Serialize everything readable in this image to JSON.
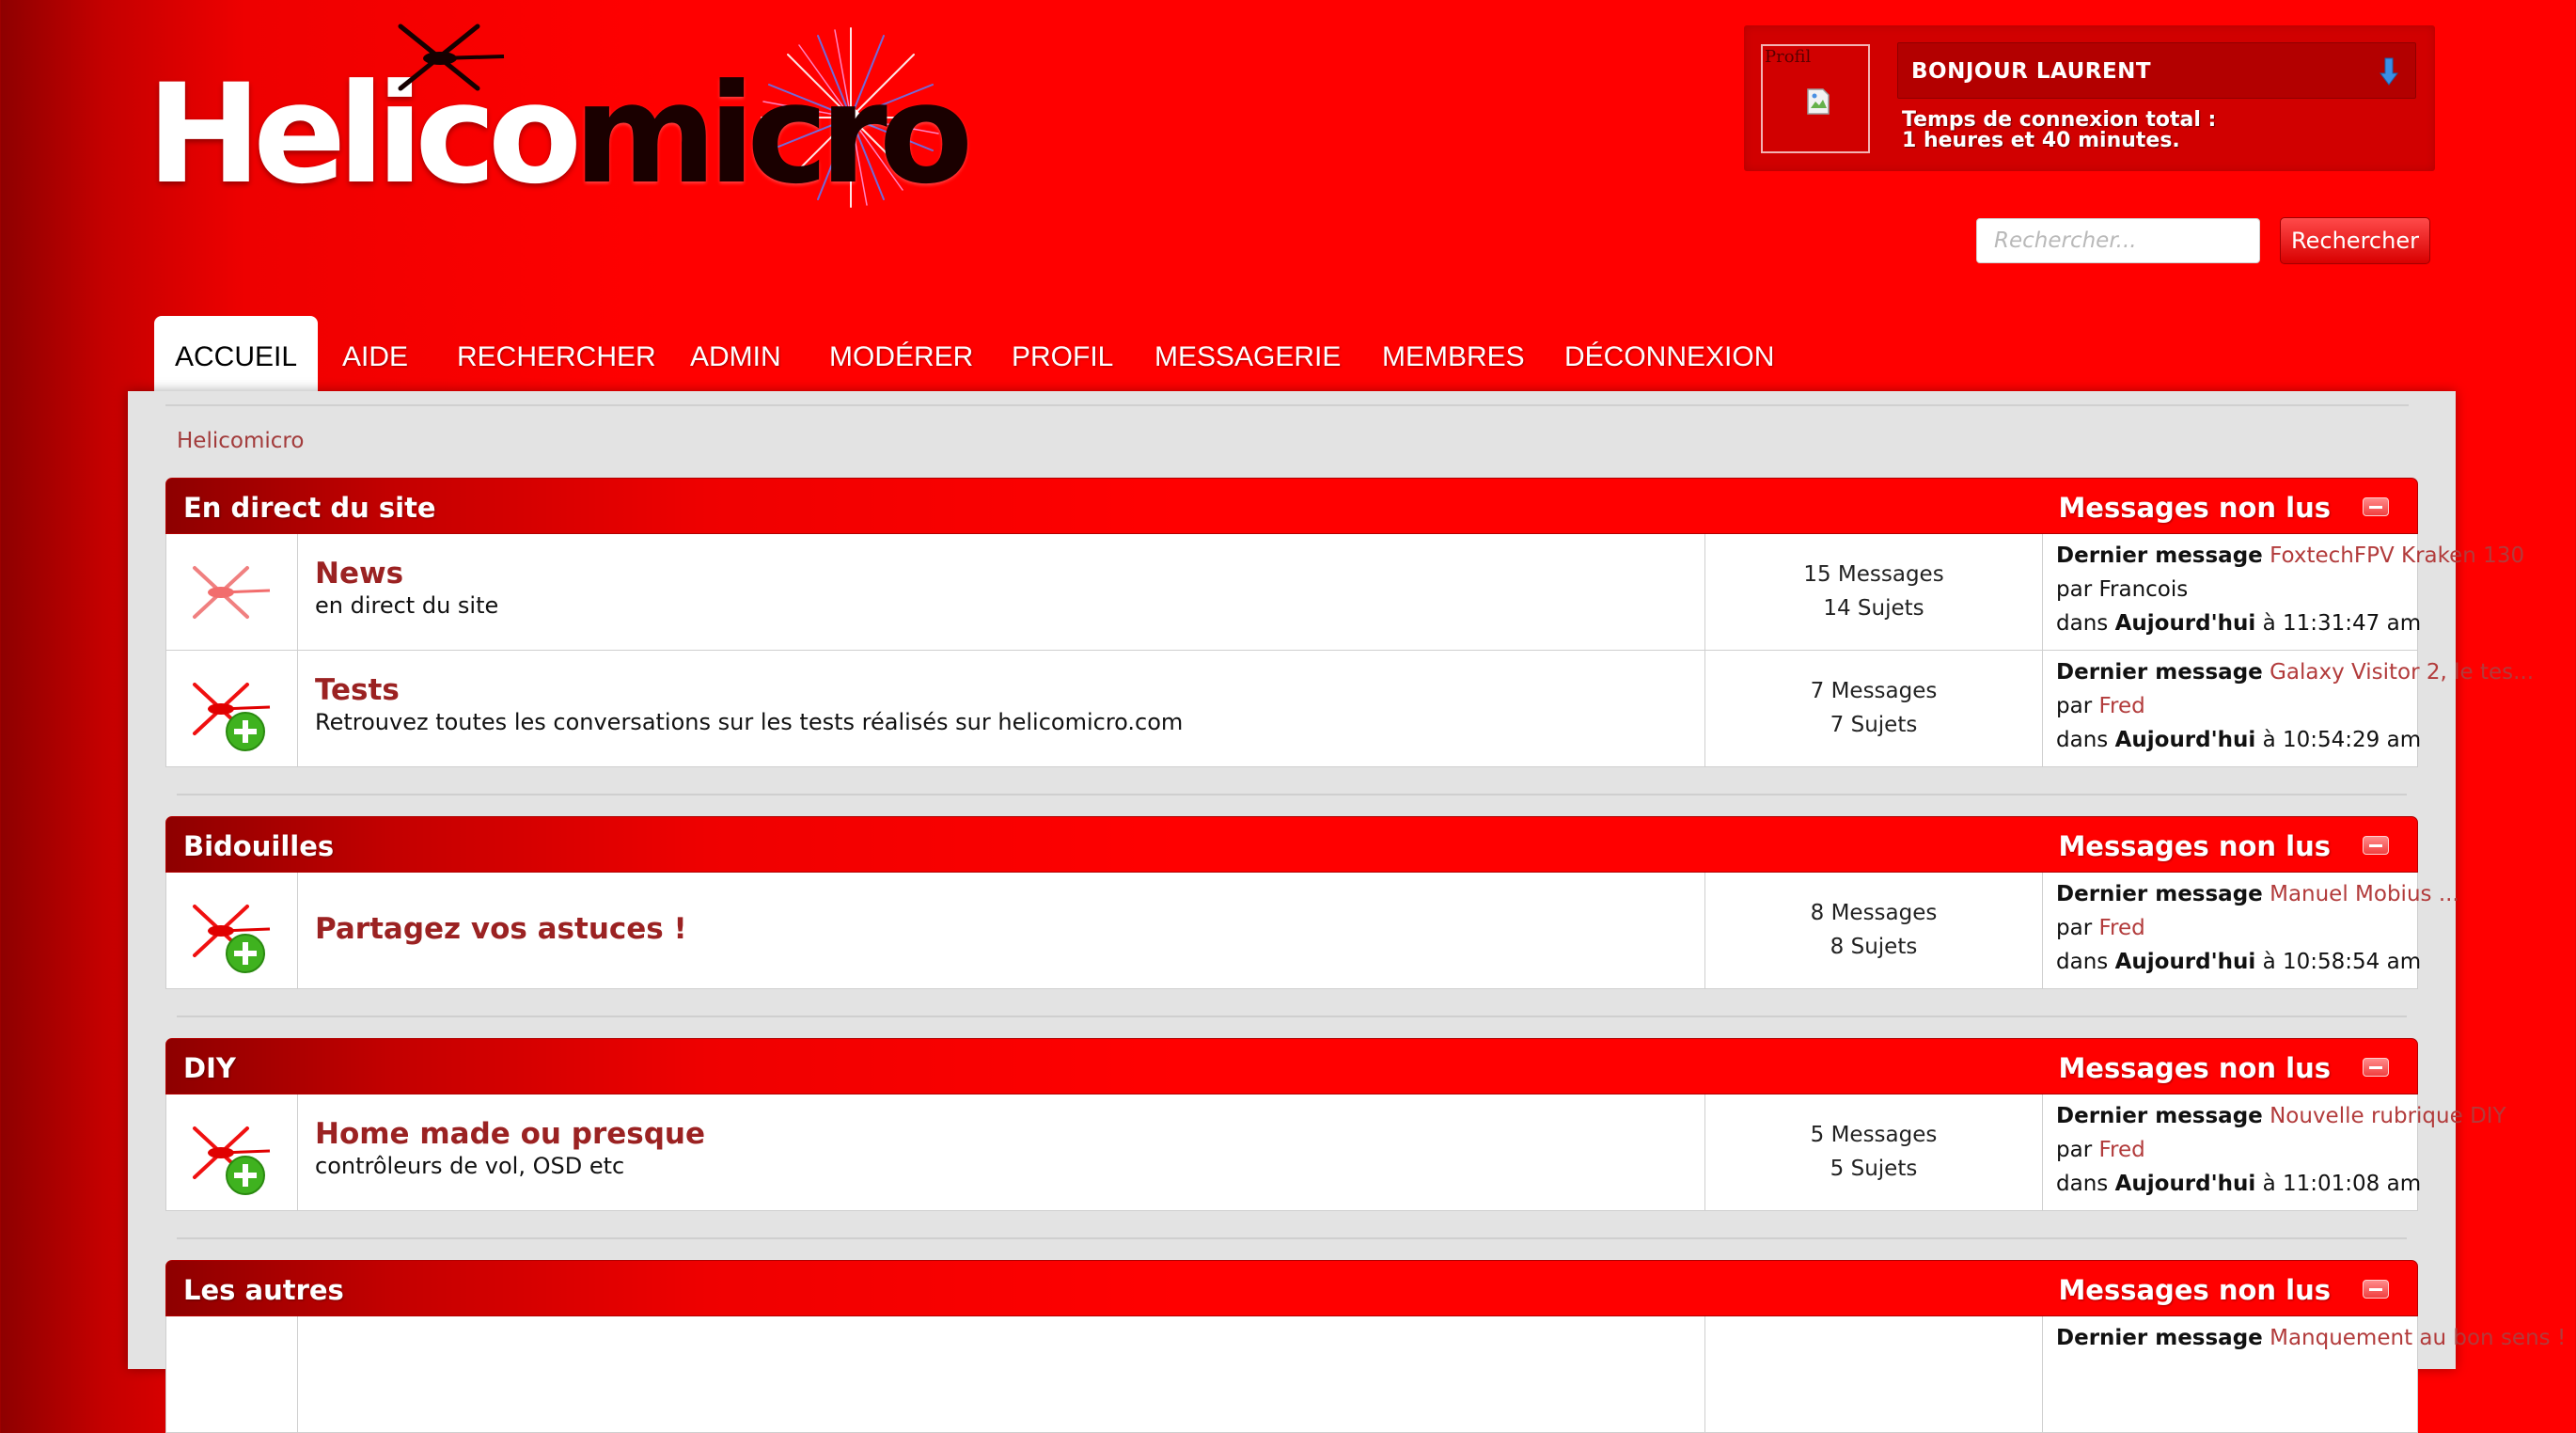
{
  "logo": {
    "part1": "Helico",
    "part2": "micro"
  },
  "user": {
    "avatar_alt": "Profil",
    "greeting": "BONJOUR LAURENT",
    "connection_line1": "Temps de connexion total :",
    "connection_line2": "1 heures et 40 minutes."
  },
  "search": {
    "placeholder": "Rechercher...",
    "button": "Rechercher"
  },
  "nav": [
    "ACCUEIL",
    "AIDE",
    "RECHERCHER",
    "ADMIN",
    "MODÉRER",
    "PROFIL",
    "MESSAGERIE",
    "MEMBRES",
    "DÉCONNEXION"
  ],
  "breadcrumb": "Helicomicro",
  "colors": {
    "primary": "#ff0000",
    "dark": "#8e0000",
    "link": "#9b2222",
    "new_badge": "#3fb21f"
  },
  "categories": [
    {
      "title": "En direct du site",
      "unread": "Messages non lus",
      "forums": [
        {
          "icon": "helicopter-icon",
          "title": "News",
          "desc": "en direct du site",
          "messages": "15 Messages",
          "subjects": "14 Sujets",
          "last_label": "Dernier message",
          "last_title": "FoxtechFPV Kraken 130",
          "par": "par",
          "author": "Francois",
          "dans": "dans",
          "day": "Aujourd'hui",
          "time": "à 11:31:47 am"
        },
        {
          "icon": "helicopter-new-icon",
          "title": "Tests",
          "desc": "Retrouvez toutes les conversations sur les tests réalisés sur helicomicro.com",
          "messages": "7 Messages",
          "subjects": "7 Sujets",
          "last_label": "Dernier message",
          "last_title": "Galaxy Visitor 2, le tes...",
          "par": "par",
          "author": "Fred",
          "dans": "dans",
          "day": "Aujourd'hui",
          "time": "à 10:54:29 am"
        }
      ]
    },
    {
      "title": "Bidouilles",
      "unread": "Messages non lus",
      "forums": [
        {
          "icon": "helicopter-new-icon",
          "title": "Partagez vos astuces !",
          "desc": "",
          "messages": "8 Messages",
          "subjects": "8 Sujets",
          "last_label": "Dernier message",
          "last_title": "Manuel Mobius ...",
          "par": "par",
          "author": "Fred",
          "dans": "dans",
          "day": "Aujourd'hui",
          "time": "à 10:58:54 am"
        }
      ]
    },
    {
      "title": "DIY",
      "unread": "Messages non lus",
      "forums": [
        {
          "icon": "helicopter-new-icon",
          "title": "Home made ou presque",
          "desc": "contrôleurs de vol, OSD etc",
          "messages": "5 Messages",
          "subjects": "5 Sujets",
          "last_label": "Dernier message",
          "last_title": "Nouvelle rubrique DIY",
          "par": "par",
          "author": "Fred",
          "dans": "dans",
          "day": "Aujourd'hui",
          "time": "à 11:01:08 am"
        }
      ]
    },
    {
      "title": "Les autres",
      "unread": "Messages non lus",
      "forums": [
        {
          "icon": "helicopter-new-icon",
          "title": "",
          "desc": "",
          "messages": "",
          "subjects": "",
          "last_label": "Dernier message",
          "last_title": "Manquement au bon sens !",
          "par": "",
          "author": "",
          "dans": "",
          "day": "",
          "time": ""
        }
      ]
    }
  ]
}
